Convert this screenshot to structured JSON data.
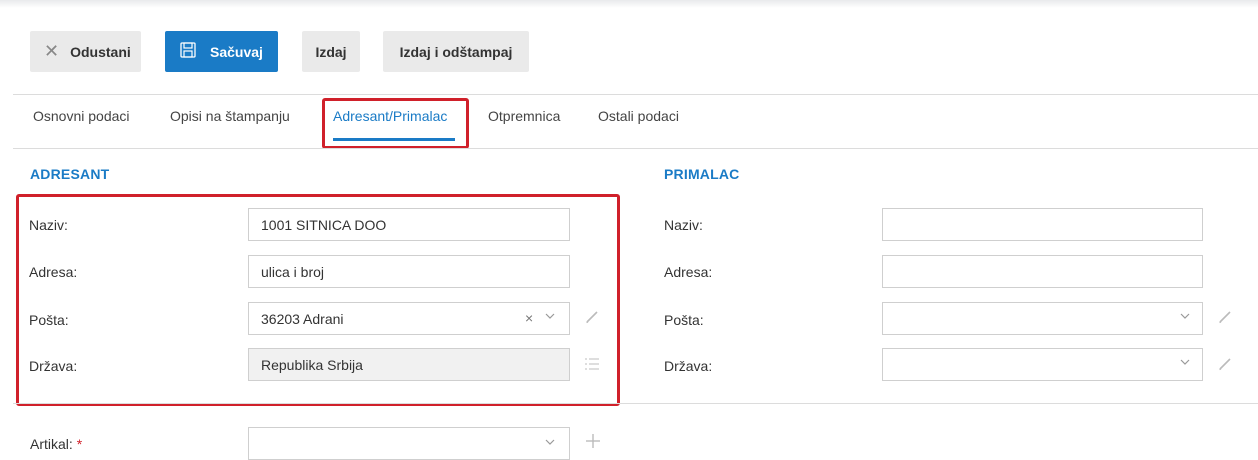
{
  "toolbar": {
    "cancel_label": "Odustani",
    "save_label": "Sačuvaj",
    "issue_label": "Izdaj",
    "issue_print_label": "Izdaj i odštampaj"
  },
  "tabs": [
    {
      "label": "Osnovni podaci"
    },
    {
      "label": "Opisi na štampanju"
    },
    {
      "label": "Adresant/Primalac"
    },
    {
      "label": "Otpremnica"
    },
    {
      "label": "Ostali podaci"
    }
  ],
  "adresant": {
    "title": "ADRESANT",
    "naziv_label": "Naziv:",
    "naziv_value": "1001 SITNICA DOO",
    "adresa_label": "Adresa:",
    "adresa_value": "ulica i broj",
    "posta_label": "Pošta:",
    "posta_value": "36203 Adrani",
    "drzava_label": "Država:",
    "drzava_value": "Republika Srbija"
  },
  "primalac": {
    "title": "PRIMALAC",
    "naziv_label": "Naziv:",
    "naziv_value": "",
    "adresa_label": "Adresa:",
    "adresa_value": "",
    "posta_label": "Pošta:",
    "posta_value": "",
    "drzava_label": "Država:",
    "drzava_value": ""
  },
  "artikal": {
    "label": "Artikal:",
    "required_mark": "*",
    "value": ""
  },
  "colors": {
    "accent": "#1a7bc6",
    "highlight": "#d0202a"
  }
}
